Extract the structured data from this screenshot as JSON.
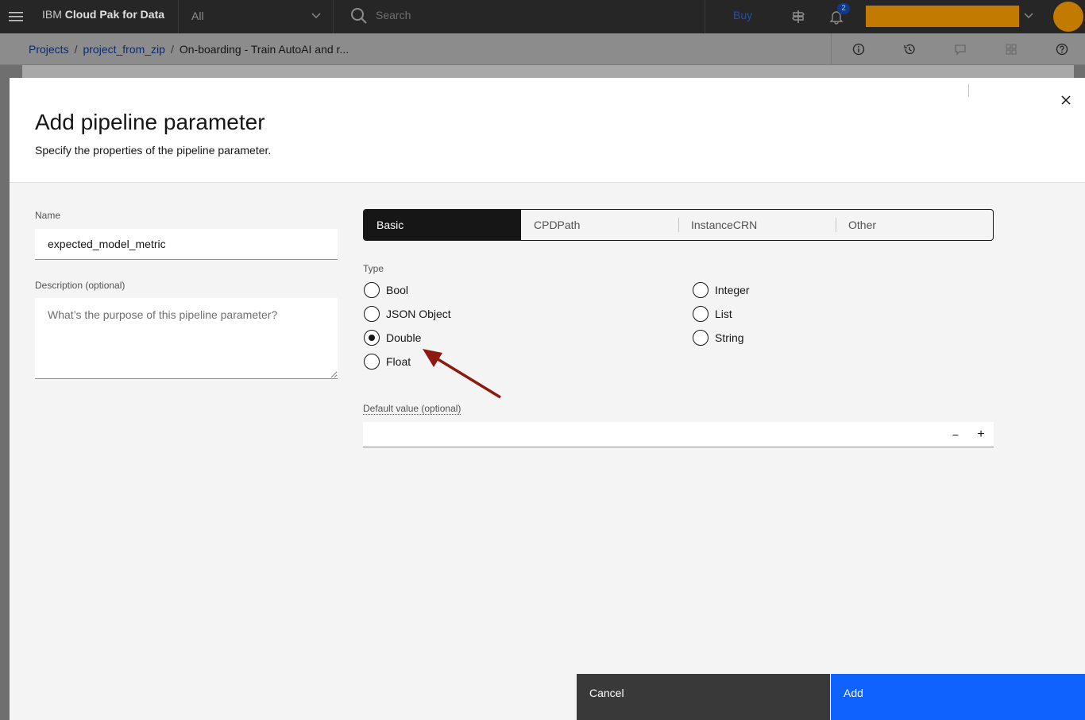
{
  "header": {
    "brand_prefix": "IBM",
    "brand_name": "Cloud Pak for Data",
    "scope_value": "All",
    "search_placeholder": "Search",
    "buy_label": "Buy",
    "notification_count": "2",
    "colors": {
      "bg": "#262626",
      "account": "#c27a00"
    }
  },
  "breadcrumb": {
    "items": [
      "Projects",
      "project_from_zip",
      "On-boarding - Train AutoAI and r..."
    ],
    "separator": "/"
  },
  "modal": {
    "title": "Add pipeline parameter",
    "subtitle": "Specify the properties of the pipeline parameter.",
    "name_label": "Name",
    "name_value": "expected_model_metric",
    "description_label": "Description (optional)",
    "description_placeholder": "What’s the purpose of this pipeline parameter?",
    "tabs": [
      {
        "label": "Basic",
        "selected": true
      },
      {
        "label": "CPDPath",
        "selected": false
      },
      {
        "label": "InstanceCRN",
        "selected": false
      },
      {
        "label": "Other",
        "selected": false
      }
    ],
    "type_label": "Type",
    "types": [
      {
        "label": "Bool",
        "checked": false
      },
      {
        "label": "JSON Object",
        "checked": false
      },
      {
        "label": "Double",
        "checked": true
      },
      {
        "label": "Float",
        "checked": false
      },
      {
        "label": "Integer",
        "checked": false
      },
      {
        "label": "List",
        "checked": false
      },
      {
        "label": "String",
        "checked": false
      }
    ],
    "default_label": "Default value (optional)",
    "default_value": "",
    "decrement_symbol": "−",
    "increment_symbol": "+",
    "cancel_label": "Cancel",
    "add_label": "Add",
    "colors": {
      "primary": "#0f62fe",
      "secondary": "#393939",
      "annotation_arrow": "#8b1a10"
    }
  }
}
